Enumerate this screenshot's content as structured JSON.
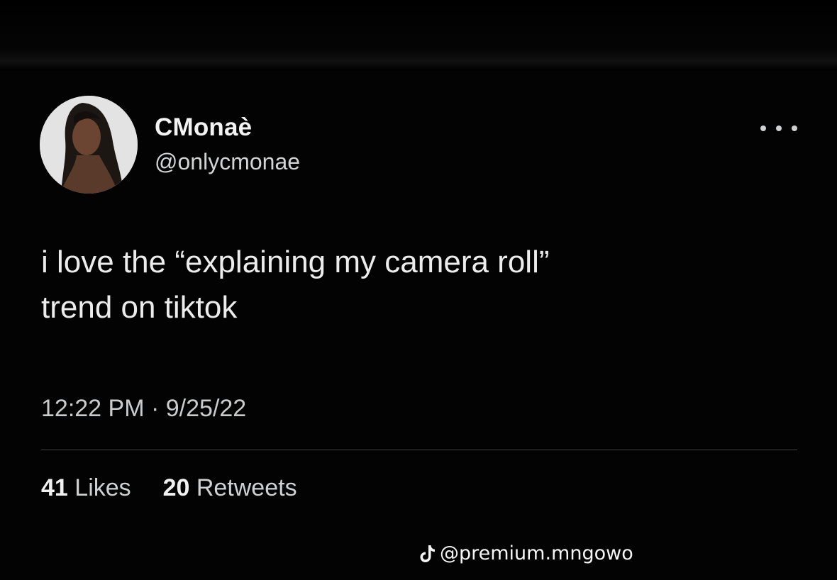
{
  "tweet": {
    "author": {
      "display_name": "CMonaè",
      "handle": "@onlycmonae",
      "avatar": "avatar"
    },
    "menu_icon": "more-horizontal-icon",
    "text_lines": [
      "i love the “explaining my camera roll”",
      "trend on tiktok"
    ],
    "time": "12:22 PM",
    "separator": "·",
    "date": "9/25/22",
    "stats": {
      "likes_count": "41",
      "likes_label": "Likes",
      "retweets_count": "20",
      "retweets_label": "Retweets"
    }
  },
  "watermark": {
    "icon": "tiktok-icon",
    "text": "@premium.mngowo"
  },
  "colors": {
    "background": "#030303",
    "text_primary": "#ececec",
    "text_secondary": "#c9cbcd",
    "divider": "#3e4144"
  }
}
